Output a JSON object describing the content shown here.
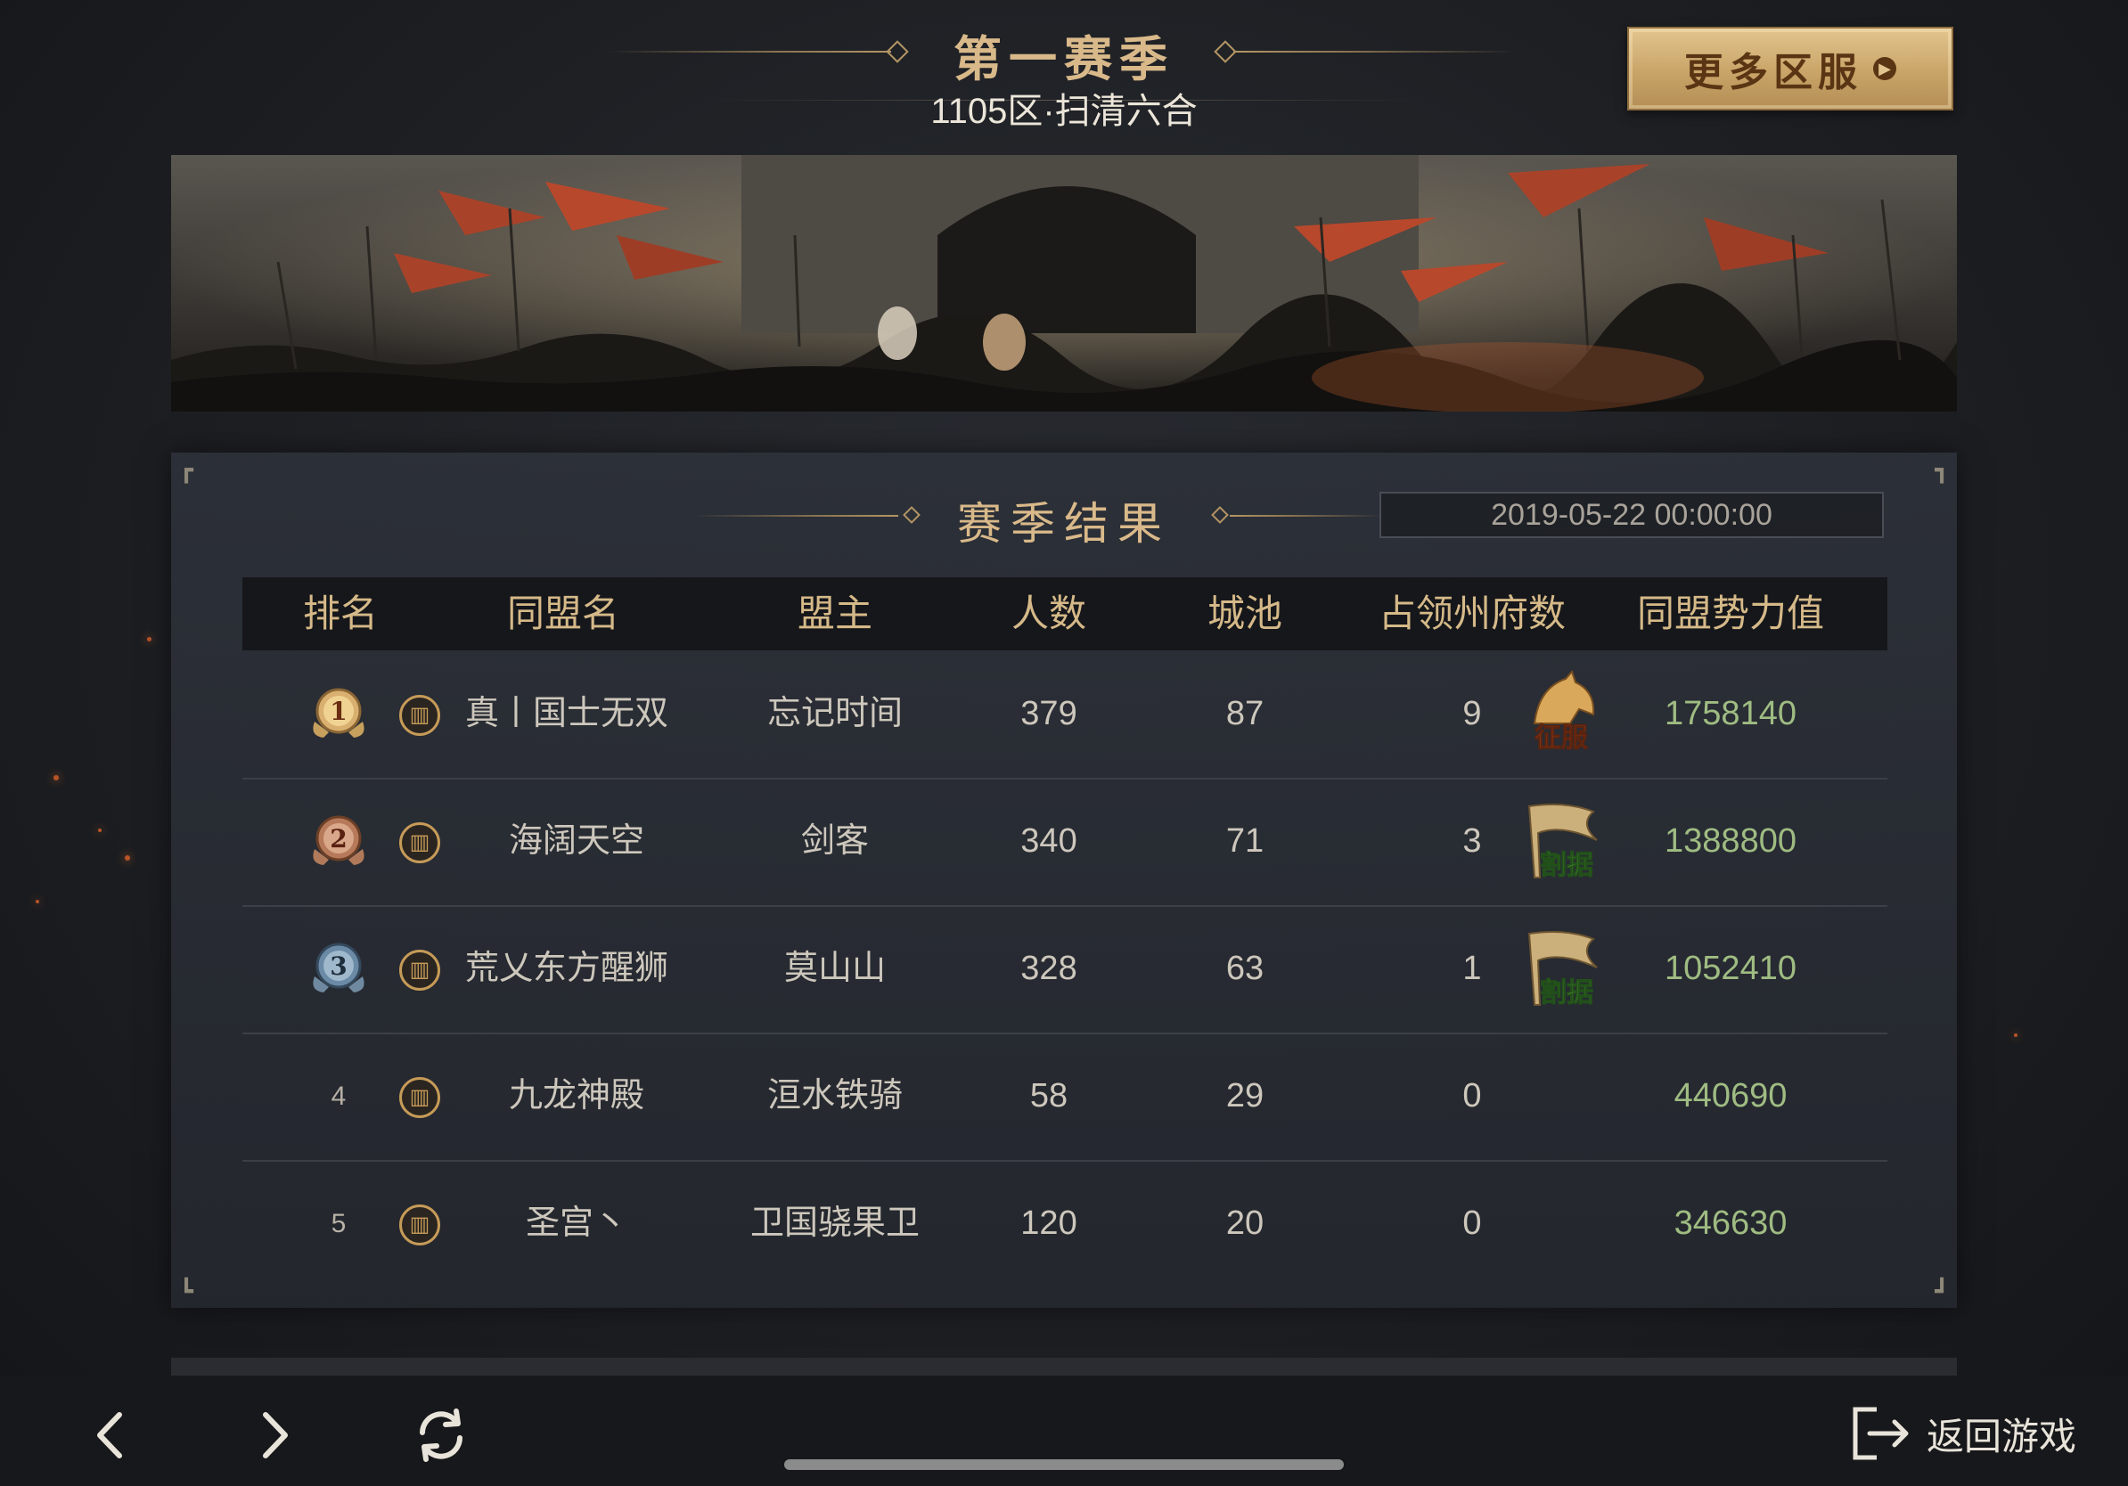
{
  "header": {
    "season_title": "第一赛季",
    "server_subtitle": "1105区·扫清六合",
    "more_servers_button": "更多区服"
  },
  "panel": {
    "title": "赛季结果",
    "date": "2019-05-22 00:00:00"
  },
  "table": {
    "columns": [
      "排名",
      "同盟名",
      "盟主",
      "人数",
      "城池",
      "占领州府数",
      "同盟势力值"
    ],
    "rows": [
      {
        "rank": "1",
        "alliance": "真丨国士无双",
        "leader": "忘记时间",
        "members": "379",
        "cities": "87",
        "prefectures": "9",
        "badge": "征服",
        "power": "1758140"
      },
      {
        "rank": "2",
        "alliance": "海阔天空",
        "leader": "剑客",
        "members": "340",
        "cities": "71",
        "prefectures": "3",
        "badge": "割据",
        "power": "1388800"
      },
      {
        "rank": "3",
        "alliance": "荒乂东方醒狮",
        "leader": "莫山山",
        "members": "328",
        "cities": "63",
        "prefectures": "1",
        "badge": "割据",
        "power": "1052410"
      },
      {
        "rank": "4",
        "alliance": "九龙神殿",
        "leader": "洹水铁骑",
        "members": "58",
        "cities": "29",
        "prefectures": "0",
        "badge": "",
        "power": "440690"
      },
      {
        "rank": "5",
        "alliance": "圣宫丶",
        "leader": "卫国骁果卫",
        "members": "120",
        "cities": "20",
        "prefectures": "0",
        "badge": "",
        "power": "346630"
      }
    ]
  },
  "bottom_bar": {
    "back_icon": "chevron-left-icon",
    "forward_icon": "chevron-right-icon",
    "refresh_icon": "refresh-icon",
    "return_label": "返回游戏"
  },
  "colors": {
    "gold": "#d9b98a",
    "power_green": "#9fbc82",
    "panel_bg": "#2c3038"
  }
}
